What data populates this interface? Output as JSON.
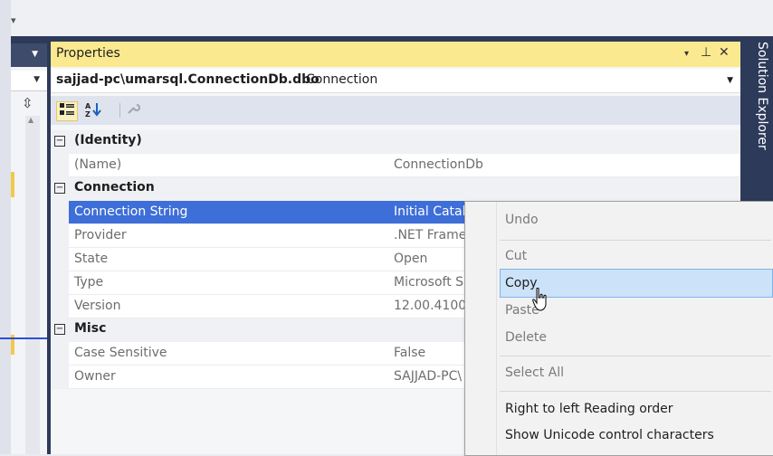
{
  "properties_window": {
    "title": "Properties",
    "title_controls": {
      "dropdown": "▾",
      "pin": "ᵩ",
      "close": "✕"
    },
    "object_name": "sajjad-pc\\umarsql.ConnectionDb.dbo",
    "object_type": "Connection",
    "toolbar": [
      {
        "name": "categorized-icon",
        "glyph": "▦"
      },
      {
        "name": "alphabetical-icon",
        "glyph": "ᴬZ↓"
      },
      {
        "name": "property-pages-icon",
        "glyph": "🔧"
      }
    ],
    "categories": [
      {
        "label": "(Identity)",
        "properties": [
          {
            "name": "(Name)",
            "value": "ConnectionDb"
          }
        ]
      },
      {
        "label": "Connection",
        "properties": [
          {
            "name": "Connection String",
            "value": "Initial Catalo"
          },
          {
            "name": "Provider",
            "value": ".NET Frame"
          },
          {
            "name": "State",
            "value": "Open"
          },
          {
            "name": "Type",
            "value": "Microsoft S"
          },
          {
            "name": "Version",
            "value": "12.00.4100"
          }
        ]
      },
      {
        "label": "Misc",
        "properties": [
          {
            "name": "Case Sensitive",
            "value": "False"
          },
          {
            "name": "Owner",
            "value": "SAJJAD-PC\\"
          }
        ]
      }
    ],
    "selected_property": "Connection String"
  },
  "side_tab": {
    "label": "Solution Explorer"
  },
  "context_menu": {
    "items": [
      {
        "label": "Undo",
        "enabled": false
      },
      {
        "label": "Cut",
        "enabled": false
      },
      {
        "label": "Copy",
        "enabled": true,
        "highlighted": true
      },
      {
        "label": "Paste",
        "enabled": false
      },
      {
        "label": "Delete",
        "enabled": false
      },
      {
        "label": "Select All",
        "enabled": false
      },
      {
        "label": "Right to left Reading order",
        "enabled": true
      },
      {
        "label": "Show Unicode control characters",
        "enabled": true
      }
    ]
  },
  "colors": {
    "title_bar": "#fbe98f",
    "selection": "#3e6ed8",
    "menu_highlight": "#cce2f9",
    "frame": "#2d3a5a"
  }
}
